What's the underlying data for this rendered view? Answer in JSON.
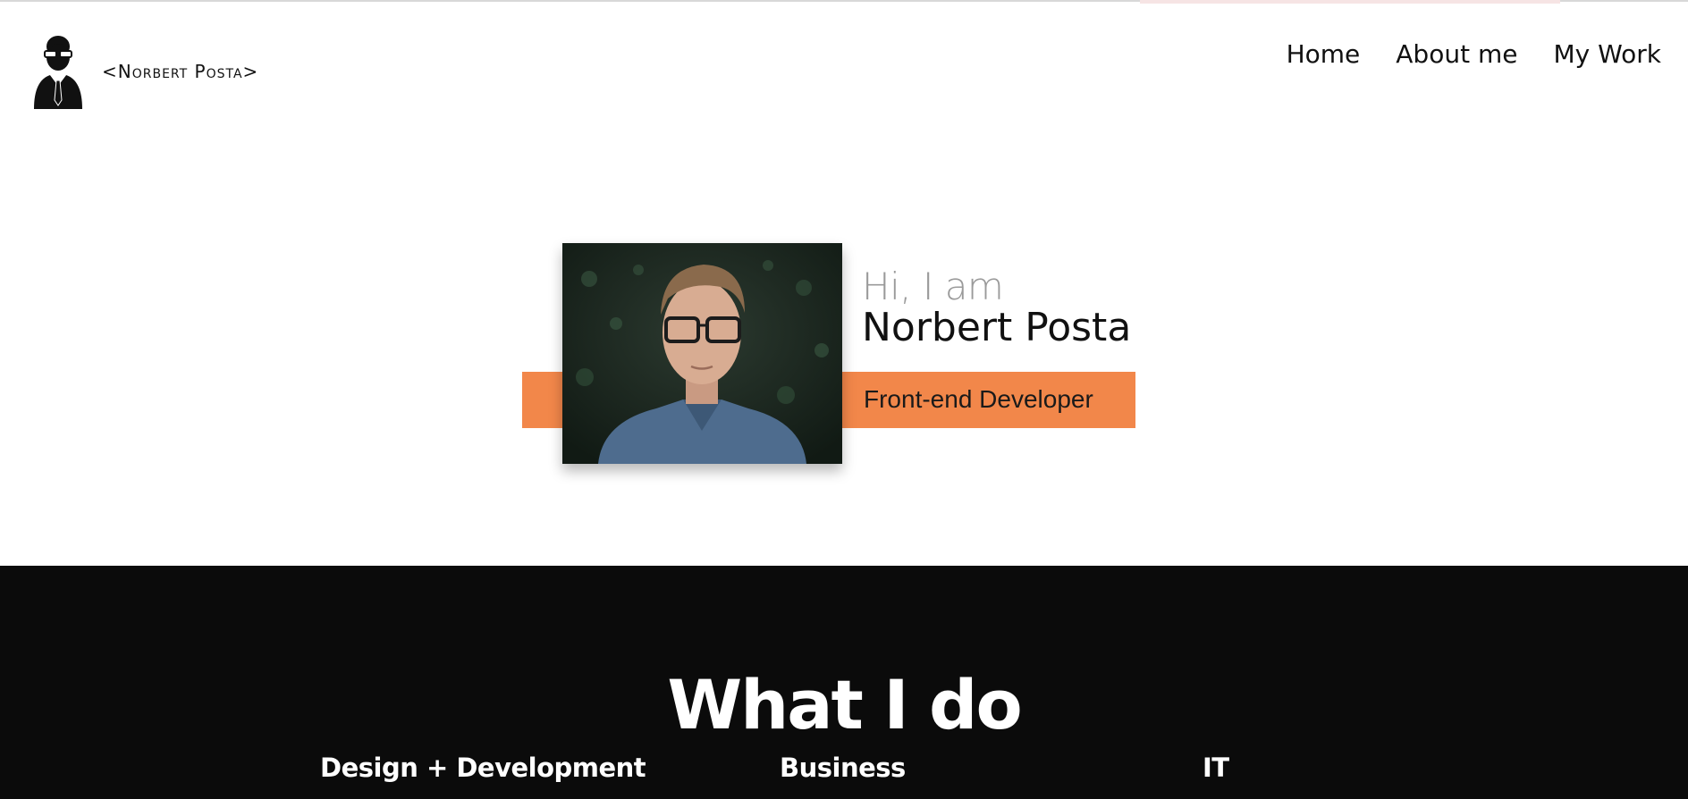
{
  "header": {
    "brand_name": "<Norbert Posta>",
    "logo_icon": "businessman-glasses-avatar-icon",
    "nav": [
      {
        "label": "Home"
      },
      {
        "label": "About me"
      },
      {
        "label": "My Work"
      }
    ]
  },
  "hero": {
    "greeting": "Hi, I am",
    "name": "Norbert Posta",
    "role": "Front-end Developer",
    "photo_icon": "profile-photo",
    "accent_color": "#f2874a"
  },
  "services": {
    "heading": "What I do",
    "columns": [
      {
        "title": "Design + Development"
      },
      {
        "title": "Business"
      },
      {
        "title": "IT"
      }
    ],
    "background_color": "#0b0b0b"
  }
}
